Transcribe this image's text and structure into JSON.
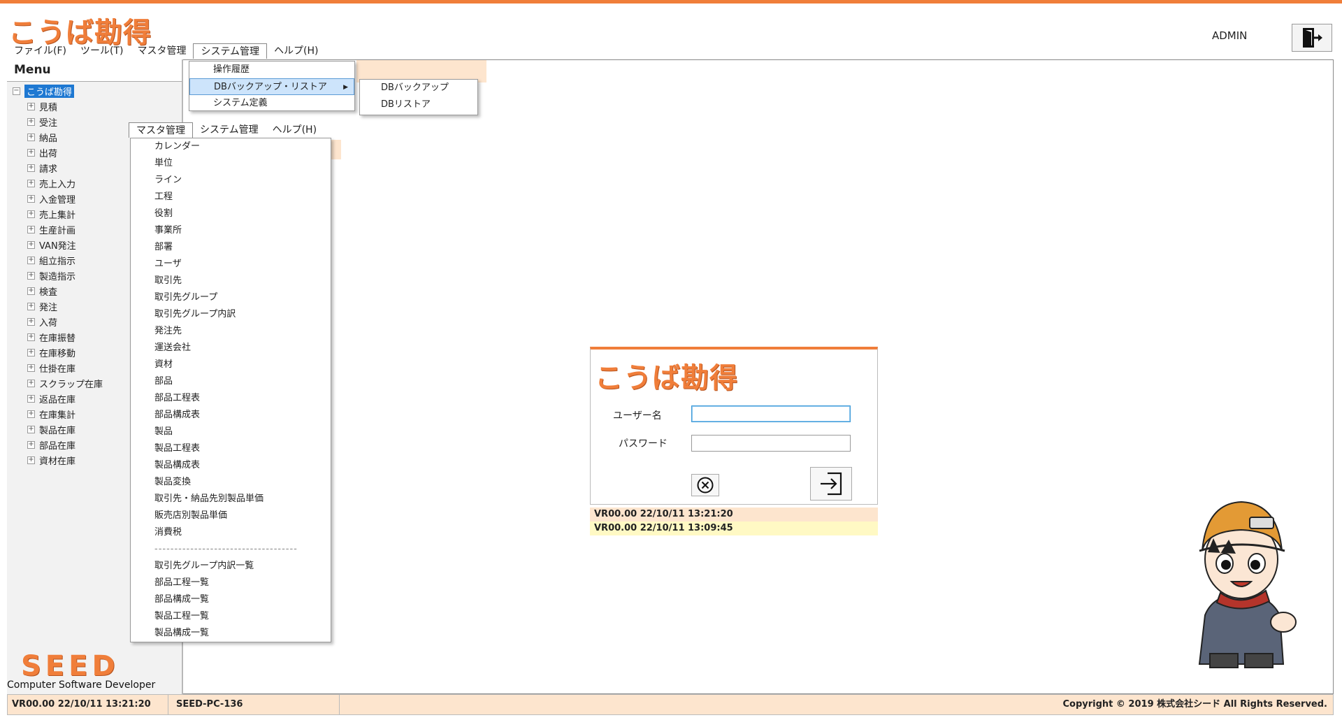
{
  "app": {
    "logo_text": "こうば勘得",
    "user": "ADMIN"
  },
  "menubar": {
    "items": [
      "ファイル(F)",
      "ツール(T)",
      "マスタ管理",
      "システム管理",
      "ヘルプ(H)"
    ]
  },
  "system_menu": {
    "items": [
      "操作履歴",
      "DBバックアップ・リストア",
      "システム定義"
    ]
  },
  "db_submenu": {
    "items": [
      "DBバックアップ",
      "DBリストア"
    ]
  },
  "menubar2": {
    "items": [
      "マスタ管理",
      "システム管理",
      "ヘルプ(H)"
    ]
  },
  "master_menu": {
    "items": [
      "カレンダー",
      "単位",
      "ライン",
      "工程",
      "役割",
      "事業所",
      "部署",
      "ユーザ",
      "取引先",
      "取引先グループ",
      "取引先グループ内訳",
      "発注先",
      "運送会社",
      "資材",
      "部品",
      "部品工程表",
      "部品構成表",
      "製品",
      "製品工程表",
      "製品構成表",
      "製品変換",
      "取引先・納品先別製品単価",
      "販売店別製品単価",
      "消費税"
    ],
    "separator": "------------------------------------",
    "items2": [
      "取引先グループ内訳一覧",
      "部品工程一覧",
      "部品構成一覧",
      "製品工程一覧",
      "製品構成一覧"
    ]
  },
  "sidebar": {
    "title": "Menu",
    "root": "こうば勘得",
    "items": [
      "見積",
      "受注",
      "納品",
      "出荷",
      "請求",
      "売上入力",
      "入金管理",
      "売上集計",
      "生産計画",
      "VAN発注",
      "組立指示",
      "製造指示",
      "検査",
      "発注",
      "入荷",
      "在庫振替",
      "在庫移動",
      "仕掛在庫",
      "スクラップ在庫",
      "返品在庫",
      "在庫集計",
      "製品在庫",
      "部品在庫",
      "資材在庫"
    ]
  },
  "seed": {
    "logo": "SEED",
    "subtitle": "Computer Software Developer"
  },
  "login": {
    "logo_text": "こうば勘得",
    "user_label": "ユーザー名",
    "password_label": "パスワード",
    "user_value": "",
    "password_value": ""
  },
  "versions": [
    "VR00.00  22/10/11 13:21:20",
    "VR00.00  22/10/11 13:09:45"
  ],
  "statusbar": {
    "version": "VR00.00  22/10/11 13:21:20",
    "machine": "SEED-PC-136",
    "copyright": "Copyright © 2019 株式会社シード All Rights Reserved."
  },
  "colors": {
    "accent": "#f07e3a",
    "peach": "#fde5ce",
    "highlight": "#cde4fb",
    "tree_selected": "#1e78d2"
  }
}
